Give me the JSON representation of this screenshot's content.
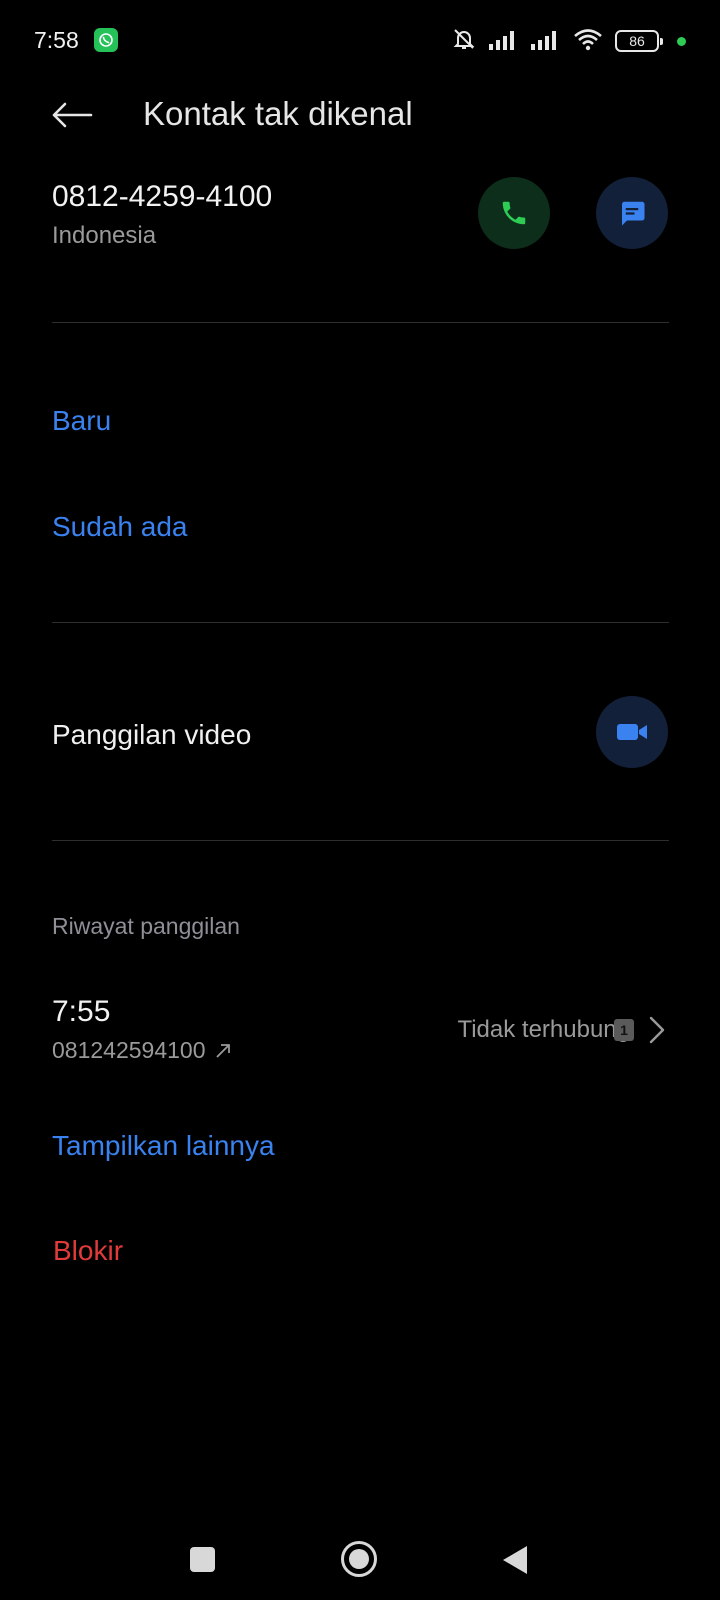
{
  "status_bar": {
    "time": "7:58",
    "battery": "86",
    "icons": [
      "whatsapp-icon",
      "mute-bell-icon",
      "signal-icon",
      "signal-icon",
      "wifi-icon",
      "battery-icon"
    ]
  },
  "header": {
    "title": "Kontak tak dikenal",
    "back_icon": "arrow-left-icon"
  },
  "contact": {
    "number": "0812-4259-4100",
    "country": "Indonesia"
  },
  "add_contact": {
    "new_label": "Baru",
    "existing_label": "Sudah ada"
  },
  "video_call": {
    "label": "Panggilan video"
  },
  "call_history": {
    "section_label": "Riwayat panggilan",
    "entries": [
      {
        "time": "7:55",
        "number": "081242594100",
        "status": "Tidak terhubung",
        "sim": "1"
      }
    ],
    "show_more_label": "Tampilkan lainnya"
  },
  "block": {
    "label": "Blokir"
  },
  "colors": {
    "accent_blue": "#3a82f0",
    "danger_red": "#e03a3a",
    "call_green": "#2ecc55",
    "background": "#000000"
  }
}
